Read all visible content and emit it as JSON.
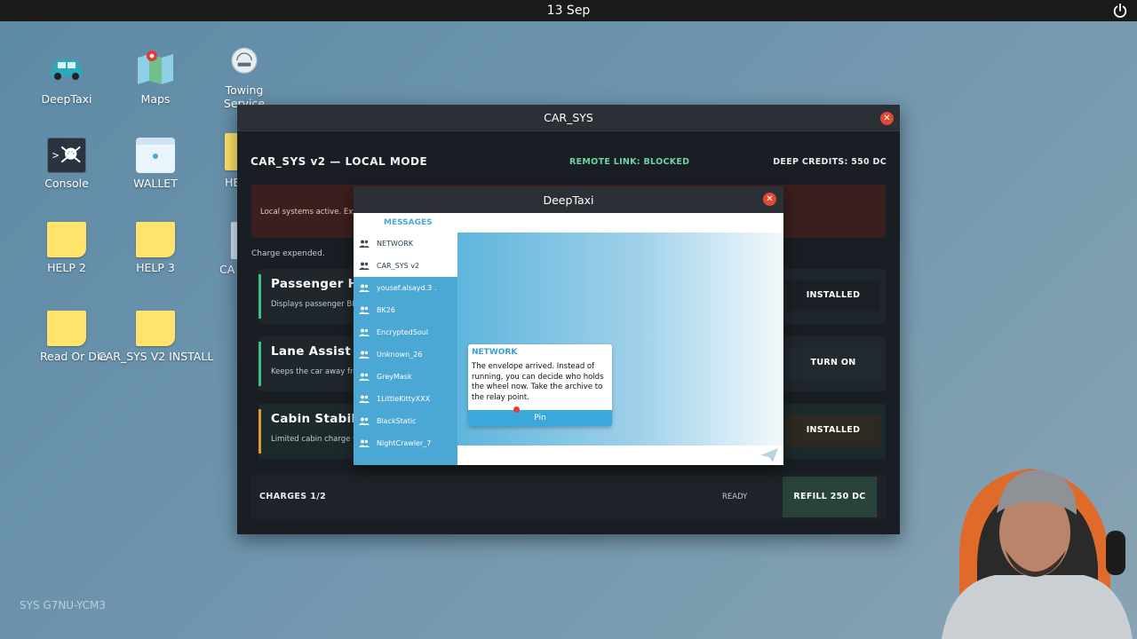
{
  "topbar": {
    "date": "13 Sep"
  },
  "desktop": {
    "icons": [
      {
        "label": "DeepTaxi",
        "icon": "taxi-icon"
      },
      {
        "label": "Maps",
        "icon": "map-icon"
      },
      {
        "label": "Towing Service",
        "label_line1": "Towing",
        "label_line2": "Service",
        "icon": "towing-clock-icon"
      },
      {
        "label": "Console",
        "icon": "console-skull-icon"
      },
      {
        "label": "WALLET",
        "icon": "wallet-icon"
      },
      {
        "label": "HE",
        "icon": "note-icon"
      },
      {
        "label": "HELP 2",
        "icon": "note-icon"
      },
      {
        "label": "HELP 3",
        "icon": "note-icon"
      },
      {
        "label": "CA",
        "icon": "file-icon"
      },
      {
        "label": "Read Or Die",
        "icon": "note-icon"
      },
      {
        "label": "CAR_SYS V2 INSTALL",
        "icon": "note-icon"
      }
    ],
    "system_code": "SYS G7NU-YCM3"
  },
  "carsys": {
    "title": "CAR_SYS",
    "heading": "CAR_SYS v2 — LOCAL MODE",
    "remote_link": "REMOTE LINK: BLOCKED",
    "credits": "DEEP CREDITS: 550 DC",
    "banner": "Local systems active. Ext",
    "charge_status": "Charge expended.",
    "modules": [
      {
        "title": "Passenger He",
        "desc": "Displays passenger BF",
        "action": "INSTALLED",
        "accent": "#3fbf7f"
      },
      {
        "title": "Lane Assist A",
        "desc": "Keeps the car away fro",
        "action": "TURN ON",
        "accent": "#3fbf7f"
      },
      {
        "title": "Cabin Stabiliz",
        "desc": "Limited cabin charge t",
        "action": "INSTALLED",
        "accent": "#e09a2e"
      }
    ],
    "footer": {
      "charges": "CHARGES 1/2",
      "status": "READY",
      "refill": "REFILL 250 DC"
    }
  },
  "deeptaxi": {
    "title": "DeepTaxi",
    "messages_tab": "MESSAGES",
    "contacts": [
      "NETWORK",
      "CAR_SYS v2",
      "yousef.alsayd.3 .",
      "BK26",
      "EncryptedSoul",
      "Unknown_26",
      "GreyMask",
      "1LittleKittyXXX",
      "BlackStatic",
      "NightCrawler_7"
    ],
    "message": {
      "sender": "NETWORK",
      "text": "The envelope arrived. Instead of running, you can decide who holds the wheel now. Take the archive to the relay point.",
      "pin_label": "Pin"
    }
  },
  "colors": {
    "accent_blue": "#4ba7d3",
    "success_green": "#6fd2a0",
    "danger_red": "#e04a33"
  }
}
